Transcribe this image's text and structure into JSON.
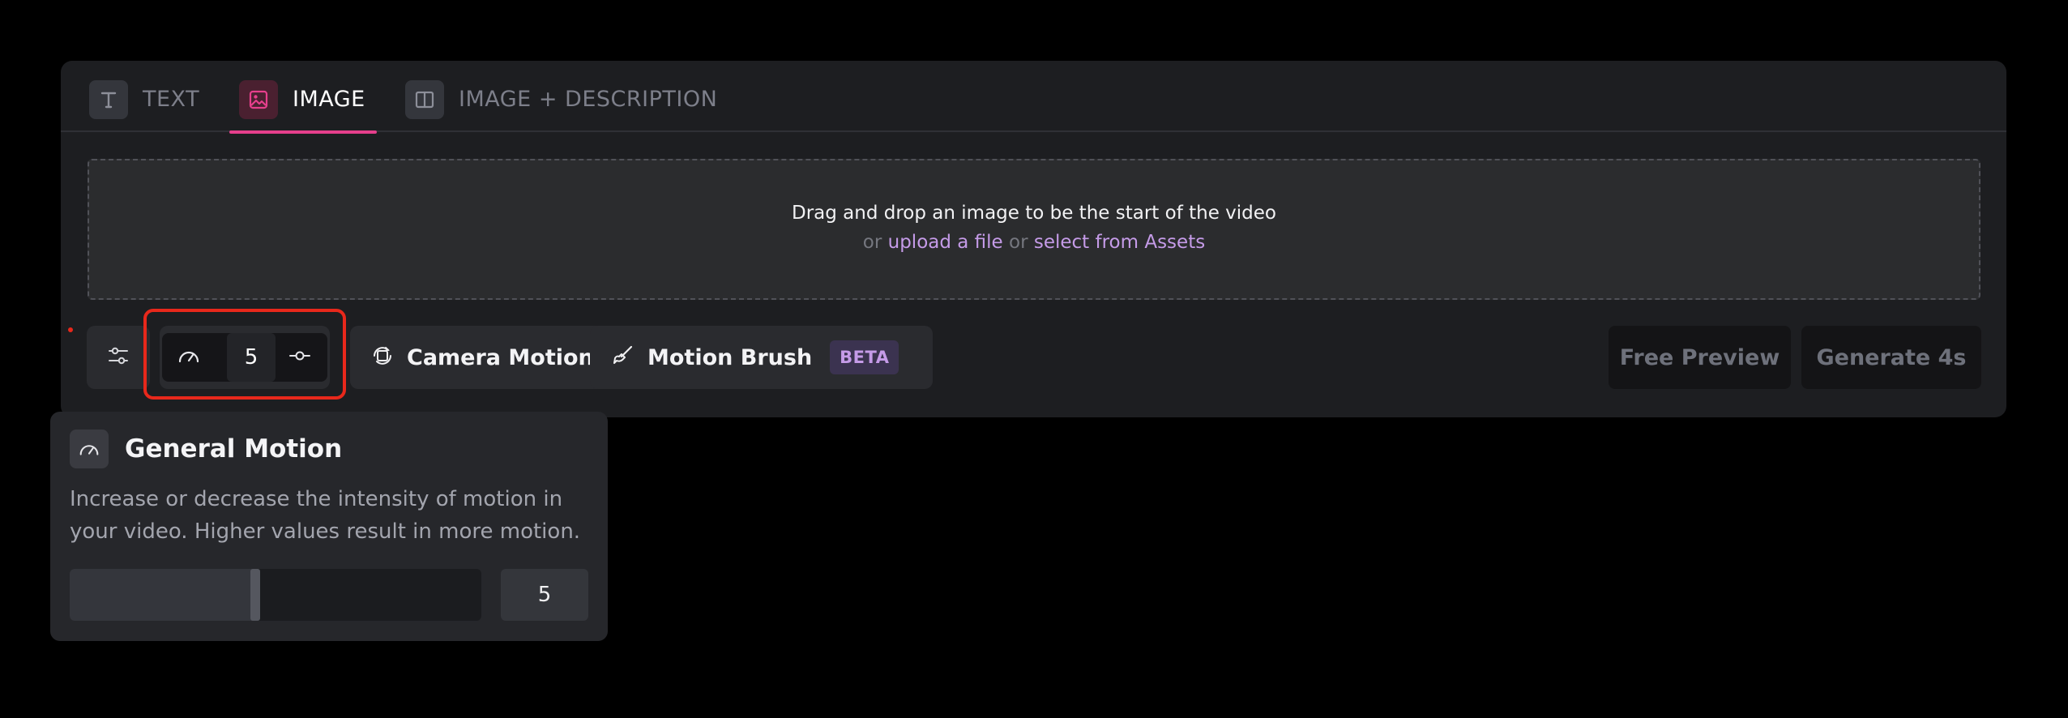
{
  "tabs": [
    {
      "label": "TEXT",
      "icon": "text-icon",
      "active": false
    },
    {
      "label": "IMAGE",
      "icon": "image-icon",
      "active": true
    },
    {
      "label": "IMAGE + DESCRIPTION",
      "icon": "split-layout-icon",
      "active": false
    }
  ],
  "dropzone": {
    "title": "Drag and drop an image to be the start of the video",
    "or1": "or",
    "upload_link": "upload a file",
    "or2": "or",
    "assets_link": "select from Assets"
  },
  "toolbar": {
    "settings_icon": "sliders-icon",
    "motion_icon": "gauge-icon",
    "motion_value": "5",
    "motion_slider_icon": "slider-handle-icon",
    "camera_label": "Camera Motion",
    "camera_icon": "camera-orbit-icon",
    "brush_label": "Motion Brush",
    "brush_icon": "brush-icon",
    "brush_badge": "BETA",
    "free_preview_label": "Free Preview",
    "generate_label": "Generate 4s"
  },
  "popover": {
    "title": "General Motion",
    "icon": "gauge-icon",
    "description": "Increase or decrease the intensity of motion in your video. Higher values result in more motion.",
    "slider_fraction": 0.45,
    "value": "5"
  },
  "colors": {
    "accent": "#e63f8c",
    "link": "#c59be8",
    "highlight": "#e8281b"
  }
}
